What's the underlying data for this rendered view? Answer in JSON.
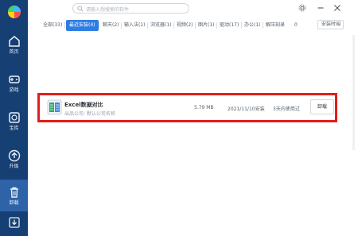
{
  "sidebar": {
    "items": [
      {
        "label": "首页",
        "icon": "home-icon"
      },
      {
        "label": "游戏",
        "icon": "gamepad-icon"
      },
      {
        "label": "宝库",
        "icon": "vault-icon"
      },
      {
        "label": "升级",
        "icon": "upgrade-icon"
      },
      {
        "label": "卸载",
        "icon": "trash-icon"
      },
      {
        "label": "",
        "icon": "download-icon"
      }
    ],
    "active_index": 4
  },
  "search": {
    "placeholder": "请输入想搜索的软件"
  },
  "window": {
    "icons": [
      "settings-icon",
      "minimize-icon",
      "close-icon"
    ]
  },
  "tabs": [
    {
      "label": "全部(33)"
    },
    {
      "label": "最近安装(4)",
      "active": true
    },
    {
      "label": "聊天(2)"
    },
    {
      "label": "输入法(1)"
    },
    {
      "label": "浏览器(1)"
    },
    {
      "label": "视频(2)"
    },
    {
      "label": "图片(1)"
    },
    {
      "label": "驱动(17)"
    },
    {
      "label": "办公(1)"
    },
    {
      "label": "解压刻录"
    },
    {
      "label": "0"
    }
  ],
  "sort": {
    "label": "安装时间"
  },
  "app_row": {
    "name": "Excel数据对比",
    "publisher": "出品公司: 默认公司名称",
    "size": "5.79 MB",
    "install_date": "2021/11/10安装",
    "last_used": "3天内使用过",
    "uninstall_label": "卸载"
  },
  "colors": {
    "sidebar": "#163f73",
    "accent": "#2f7de1",
    "highlight": "#e41c1c"
  }
}
